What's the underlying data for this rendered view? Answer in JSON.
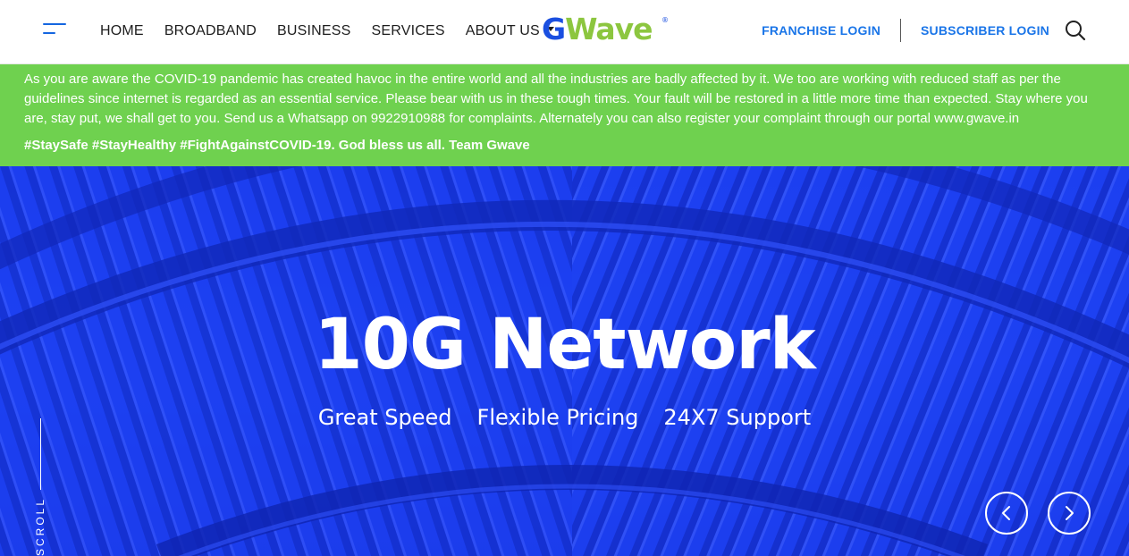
{
  "header": {
    "nav": [
      {
        "label": "HOME"
      },
      {
        "label": "BROADBAND"
      },
      {
        "label": "BUSINESS"
      },
      {
        "label": "SERVICES"
      },
      {
        "label": "ABOUT US"
      }
    ],
    "logo": {
      "text_g": "G",
      "text_rest": "Wave",
      "reg": "®"
    },
    "franchise_login": "FRANCHISE LOGIN",
    "subscriber_login": "SUBSCRIBER LOGIN"
  },
  "notice": {
    "text": "As you are aware the COVID-19 pandemic has created havoc in the entire world and all the industries are badly affected by it. We too are working with reduced staff as per the guidelines since internet is regarded as an essential service. Please bear with us in these tough times. Your fault will be restored in a little more time than expected. Stay where you are, stay put, we shall get to you. Send us a Whatsapp on 9922910988 for complaints. Alternately you can also register your complaint through our portal www.gwave.in",
    "tags": "#StaySafe #StayHealthy #FightAgainstCOVID-19. God bless us all. Team Gwave"
  },
  "hero": {
    "title": "10G Network",
    "features": [
      "Great Speed",
      "Flexible Pricing",
      "24X7 Support"
    ],
    "scroll_label": "SCROLL"
  },
  "colors": {
    "accent_blue": "#1a75e8",
    "logo_blue": "#1a4fe0",
    "logo_green": "#8cc63f",
    "notice_green": "#6fd14f",
    "hero_blue": "#1a3cf0"
  },
  "icons": {
    "menu": "hamburger-menu-icon",
    "search": "search-icon",
    "prev": "chevron-left-icon",
    "next": "chevron-right-icon"
  }
}
